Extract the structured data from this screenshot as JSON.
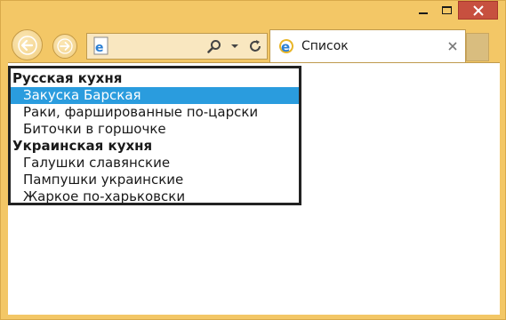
{
  "window": {
    "caption_buttons": [
      "minimize",
      "maximize",
      "close"
    ]
  },
  "navigation": {
    "back_icon": "back-arrow-icon",
    "forward_icon": "forward-arrow-icon",
    "address_value": ""
  },
  "tab": {
    "label": "Список",
    "icon": "ie-page-icon"
  },
  "colors": {
    "frame": "#f3c766",
    "selection": "#2a9cde",
    "close_button": "#c7503f"
  },
  "listbox": {
    "groups": [
      {
        "label": "Русская кухня",
        "options": [
          {
            "label": "Закуска Барская",
            "selected": true
          },
          {
            "label": "Раки, фаршированные по-царски",
            "selected": false
          },
          {
            "label": "Биточки в горшочке",
            "selected": false
          }
        ]
      },
      {
        "label": "Украинская кухня",
        "options": [
          {
            "label": "Галушки славянские",
            "selected": false
          },
          {
            "label": "Пампушки украинские",
            "selected": false
          },
          {
            "label": "Жаркое по-харьковски",
            "selected": false
          }
        ]
      }
    ]
  }
}
